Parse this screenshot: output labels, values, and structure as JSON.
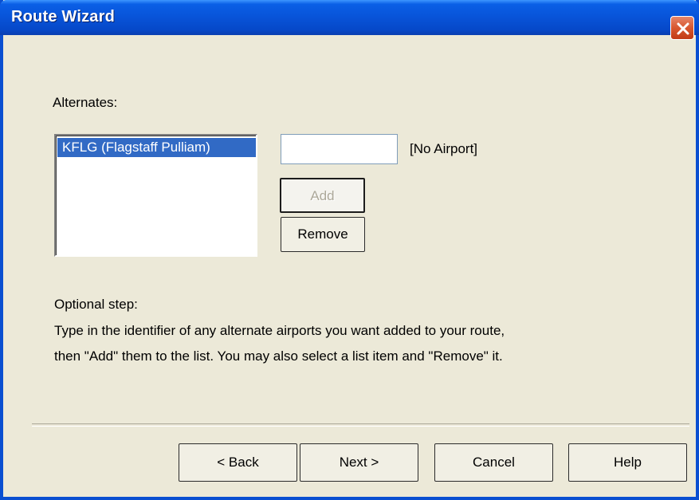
{
  "window": {
    "title": "Route Wizard",
    "close_icon": "close-icon"
  },
  "alternates": {
    "label": "Alternates:",
    "list_items": [
      "KFLG (Flagstaff Pulliam)"
    ],
    "input_value": "",
    "airport_status": "[No Airport]",
    "add_label": "Add",
    "remove_label": "Remove"
  },
  "instructions": {
    "line1": "Optional step:",
    "line2": "Type in the identifier of any alternate airports you want added to your route,",
    "line3": "then \"Add\" them to the list.  You may also select a list item and \"Remove\" it."
  },
  "footer": {
    "back_label": "< Back",
    "next_label": "Next >",
    "cancel_label": "Cancel",
    "help_label": "Help"
  },
  "colors": {
    "titlebar": "#0853d8",
    "selection": "#316ac5",
    "dialog_bg": "#ece9d8",
    "close_button": "#d8572f"
  }
}
